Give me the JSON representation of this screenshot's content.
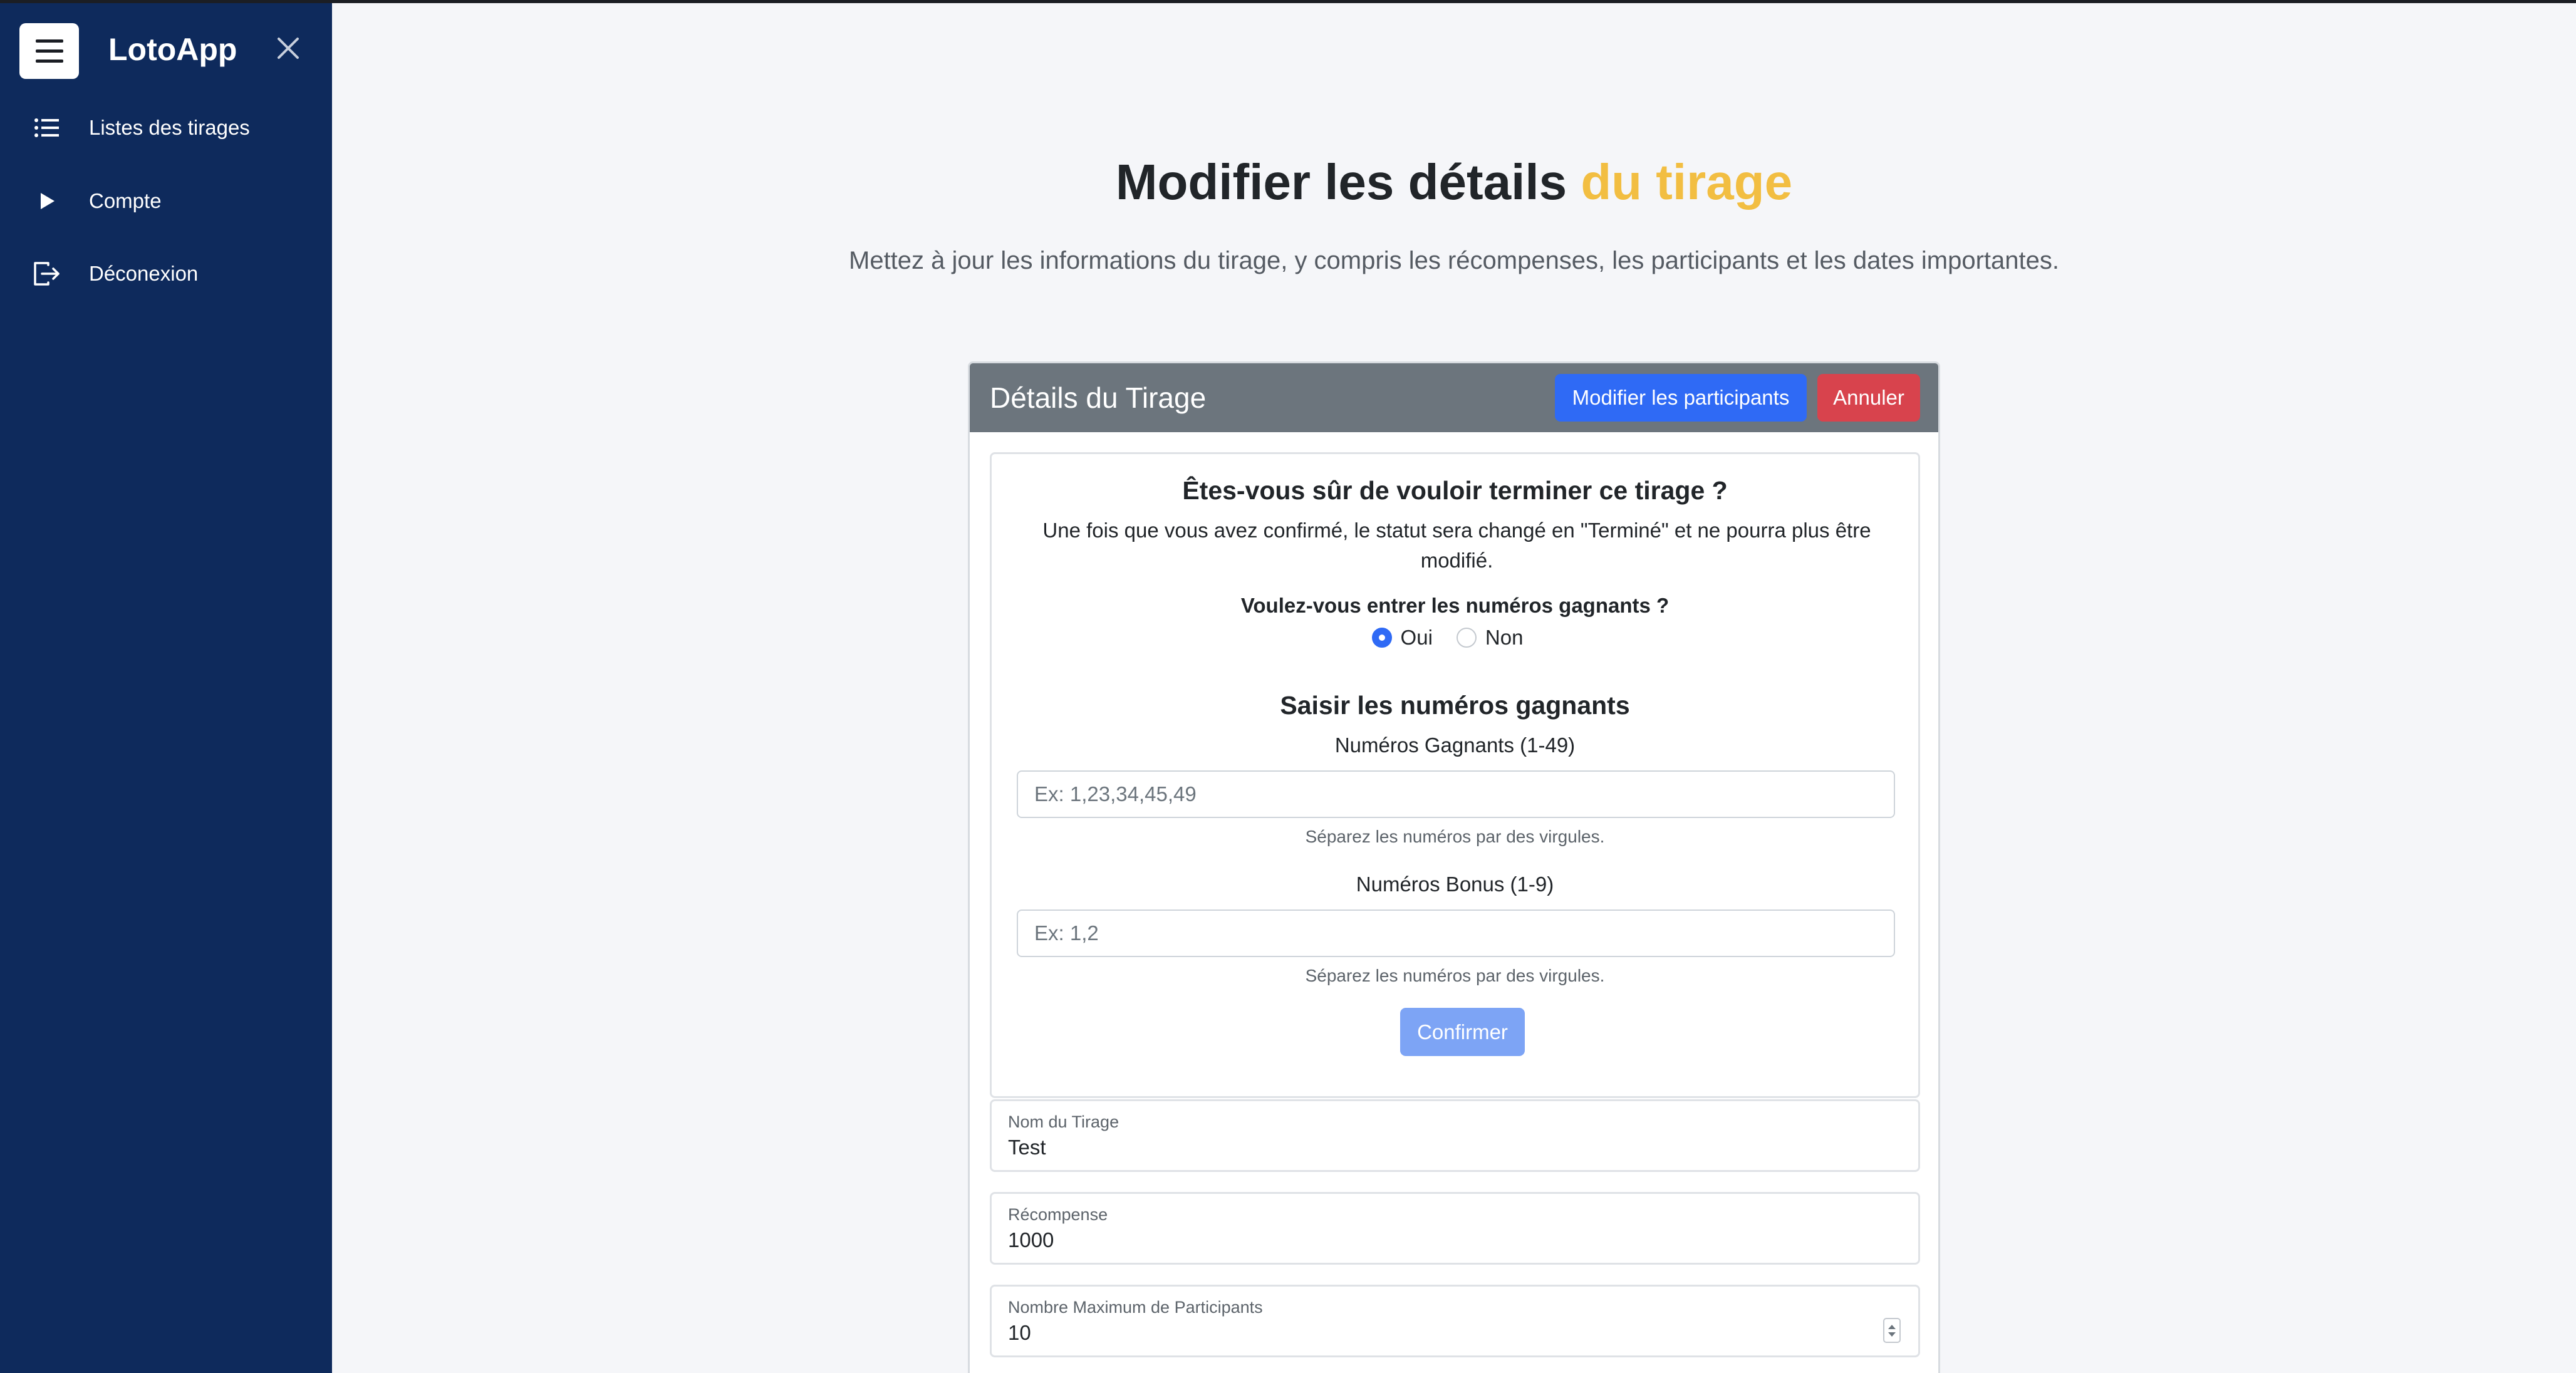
{
  "sidebar": {
    "brand": "LotoApp",
    "items": [
      {
        "label": "Listes des tirages",
        "icon": "list-icon"
      },
      {
        "label": "Compte",
        "icon": "play-icon"
      },
      {
        "label": "Déconexion",
        "icon": "logout-icon"
      }
    ]
  },
  "header": {
    "title_main": "Modifier les détails",
    "title_accent": "du tirage",
    "subtitle": "Mettez à jour les informations du tirage, y compris les récompenses, les participants et les dates importantes."
  },
  "card": {
    "title": "Détails du Tirage",
    "edit_participants_label": "Modifier les participants",
    "cancel_label": "Annuler"
  },
  "confirm": {
    "title": "Êtes-vous sûr de vouloir terminer ce tirage ?",
    "text": "Une fois que vous avez confirmé, le statut sera changé en \"Terminé\" et ne pourra plus être modifié.",
    "question": "Voulez-vous entrer les numéros gagnants ?",
    "option_yes": "Oui",
    "option_no": "Non",
    "selected": "Oui",
    "section_title": "Saisir les numéros gagnants",
    "winning_label": "Numéros Gagnants (1-49)",
    "winning_placeholder": "Ex: 1,23,34,45,49",
    "winning_help": "Séparez les numéros par des virgules.",
    "bonus_label": "Numéros Bonus (1-9)",
    "bonus_placeholder": "Ex: 1,2",
    "bonus_help": "Séparez les numéros par des virgules.",
    "confirm_label": "Confirmer"
  },
  "form": {
    "name_label": "Nom du Tirage",
    "name_value": "Test",
    "reward_label": "Récompense",
    "reward_value": "1000",
    "max_label": "Nombre Maximum de Participants",
    "max_value": "10"
  },
  "colors": {
    "sidebar": "#0e2a5c",
    "accent": "#f2be42",
    "primary": "#2f6af5",
    "danger": "#d8434d",
    "card_header": "#6c757d"
  }
}
